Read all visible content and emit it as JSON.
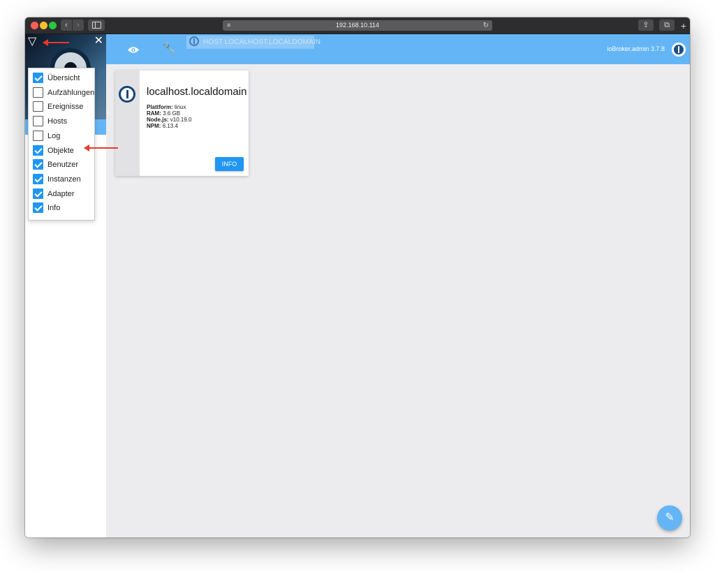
{
  "browser": {
    "url": "192.168.10.114",
    "back_glyph": "‹",
    "forward_glyph": "›",
    "reload_glyph": "↻",
    "menu_glyph": "≡",
    "share_glyph": "⇪",
    "tabs_glyph": "⧉",
    "newtab_glyph": "+"
  },
  "nav": {
    "filter_glyph": "▽",
    "close_glyph": "✕",
    "items": [
      {
        "label": "Übersicht",
        "checked": true
      },
      {
        "label": "Aufzählungen",
        "checked": false
      },
      {
        "label": "Ereignisse",
        "checked": false
      },
      {
        "label": "Hosts",
        "checked": false
      },
      {
        "label": "Log",
        "checked": false
      },
      {
        "label": "Objekte",
        "checked": true
      },
      {
        "label": "Benutzer",
        "checked": true
      },
      {
        "label": "Instanzen",
        "checked": true
      },
      {
        "label": "Adapter",
        "checked": true
      },
      {
        "label": "Info",
        "checked": true
      }
    ]
  },
  "appbar": {
    "wrench_glyph": "🔧",
    "host_tab_label": "HOST LOCALHOST.LOCALDOMAIN",
    "version": "ioBroker.admin 3.7.8"
  },
  "host_card": {
    "title": "localhost.localdomain",
    "platform_key": "Plattform:",
    "platform_value": "linux",
    "ram_key": "RAM:",
    "ram_value": "3.6 GB",
    "node_key": "Node.js:",
    "node_value": "v10.19.0",
    "npm_key": "NPM:",
    "npm_value": "6.13.4",
    "info_button": "INFO"
  },
  "fab": {
    "glyph": "✎"
  },
  "colors": {
    "appbar": "#64b5f6",
    "accent": "#2196f3",
    "annotation": "#e8392b"
  }
}
